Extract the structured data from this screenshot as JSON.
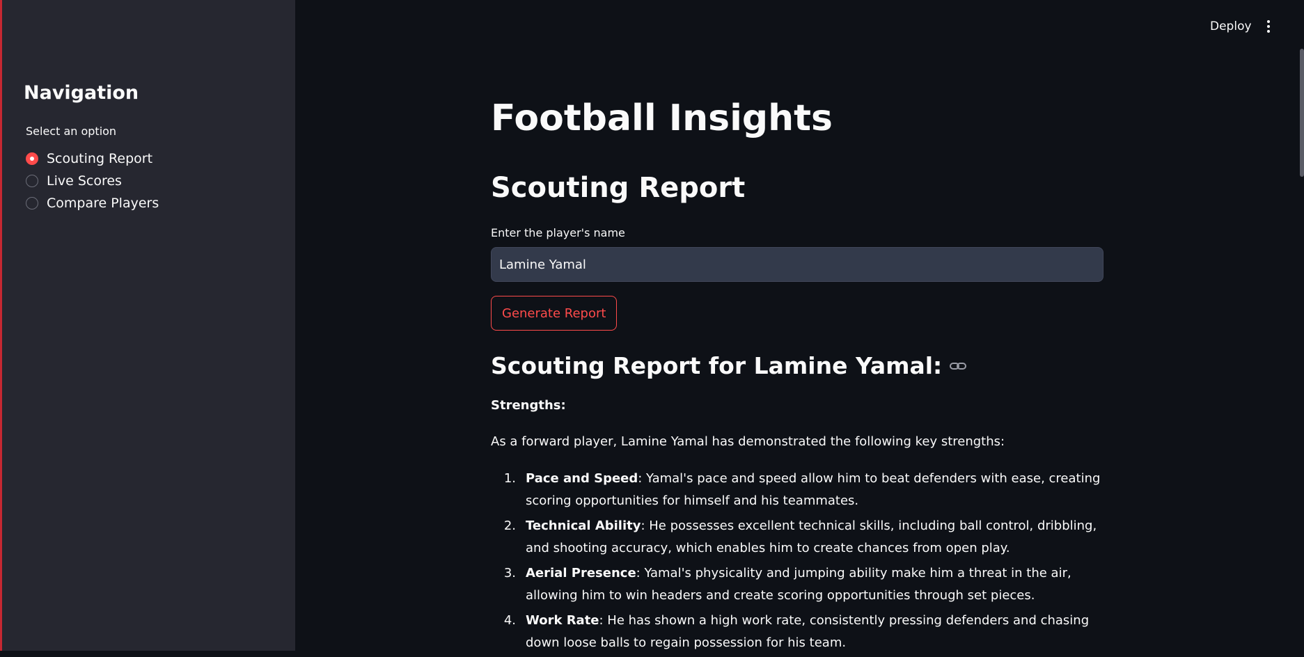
{
  "header": {
    "deploy_label": "Deploy",
    "menu_icon": "more-vertical-icon"
  },
  "sidebar": {
    "title": "Navigation",
    "radio_label": "Select an option",
    "options": [
      {
        "label": "Scouting Report",
        "checked": true
      },
      {
        "label": "Live Scores",
        "checked": false
      },
      {
        "label": "Compare Players",
        "checked": false
      }
    ]
  },
  "main": {
    "title": "Football Insights",
    "section_title": "Scouting Report",
    "input_label": "Enter the player's name",
    "input_value": "Lamine Yamal",
    "button_label": "Generate Report",
    "report_heading": "Scouting Report for Lamine Yamal:",
    "link_icon": "link-icon",
    "strengths_label": "Strengths:",
    "intro": "As a forward player, Lamine Yamal has demonstrated the following key strengths:",
    "strengths": [
      {
        "num": "1.",
        "title": "Pace and Speed",
        "text": ": Yamal's pace and speed allow him to beat defenders with ease, creating scoring opportunities for himself and his teammates."
      },
      {
        "num": "2.",
        "title": "Technical Ability",
        "text": ": He possesses excellent technical skills, including ball control, dribbling, and shooting accuracy, which enables him to create chances from open play."
      },
      {
        "num": "3.",
        "title": "Aerial Presence",
        "text": ": Yamal's physicality and jumping ability make him a threat in the air, allowing him to win headers and create scoring opportunities through set pieces."
      },
      {
        "num": "4.",
        "title": "Work Rate",
        "text": ": He has shown a high work rate, consistently pressing defenders and chasing down loose balls to regain possession for his team."
      }
    ]
  },
  "colors": {
    "accent": "#ff4b4b",
    "background": "#0e1117",
    "sidebar": "#262730",
    "input_bg": "#333a4b"
  }
}
